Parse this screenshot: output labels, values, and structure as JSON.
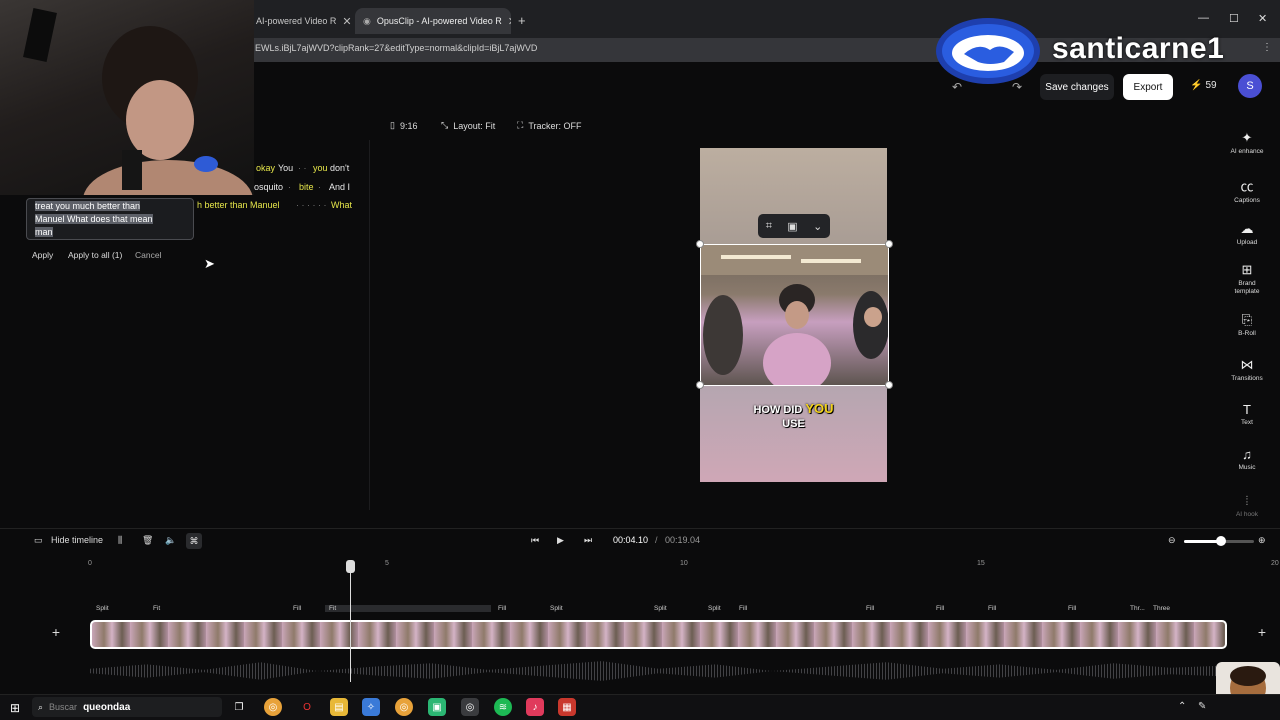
{
  "browser": {
    "tabs": [
      {
        "label": "AI-powered Video R",
        "active": false
      },
      {
        "label": "OpusClip - AI-powered Video R",
        "active": true
      }
    ],
    "url": "EWLs.iBjL7ajWVD?clipRank=27&editType=normal&clipId=iBjL7ajWVD"
  },
  "overlay": {
    "brand_name": "santicarne1"
  },
  "header": {
    "save_label": "Save changes",
    "export_label": "Export",
    "credits": "59",
    "avatar_letter": "S"
  },
  "toolbar": {
    "ratio": "9:16",
    "layout": "Layout: Fit",
    "tracker": "Tracker: OFF"
  },
  "transcript": {
    "line1a": "okay",
    "line1b": "You",
    "line1c": "you",
    "line1d": "don't",
    "line2a": "osquito",
    "line2b": "bite",
    "line2c": "And I",
    "line3a": "h better than Manuel",
    "line3b": "· · · · · ·",
    "line3c": "What",
    "editing_text_1": "treat you much better than",
    "editing_text_2": "Manuel What does that mean",
    "editing_text_3": "man",
    "apply_label": "Apply",
    "apply_all_label": "Apply to all (1)",
    "cancel_label": "Cancel"
  },
  "preview": {
    "caption_line1_a": "HOW DID",
    "caption_line1_b": "YOU",
    "caption_line2": "USE"
  },
  "sidebar": {
    "items": [
      {
        "label": "AI enhance",
        "icon": "sparkle-icon"
      },
      {
        "label": "Captions",
        "icon": "cc-icon"
      },
      {
        "label": "Upload",
        "icon": "upload-icon"
      },
      {
        "label": "Brand template",
        "icon": "brand-icon"
      },
      {
        "label": "B-Roll",
        "icon": "broll-icon"
      },
      {
        "label": "Transitions",
        "icon": "transitions-icon"
      },
      {
        "label": "Text",
        "icon": "text-icon"
      },
      {
        "label": "Music",
        "icon": "music-icon"
      },
      {
        "label": "AI hook",
        "icon": "waveform-icon"
      }
    ]
  },
  "timeline": {
    "hide_label": "Hide timeline",
    "current_time": "00:04.10",
    "total_time": "00:19.04",
    "ruler_ticks": [
      "0",
      "5",
      "10",
      "15",
      "20"
    ],
    "segment_labels": [
      "Split",
      "Fit",
      "Fill",
      "Fit",
      "Fill",
      "Split",
      "Split",
      "Split",
      "Fill",
      "Fill",
      "Fill",
      "Fill",
      "Fill",
      "Thr...",
      "Three"
    ]
  },
  "taskbar": {
    "search_placeholder": "Buscar",
    "search_text": "queondaa"
  }
}
